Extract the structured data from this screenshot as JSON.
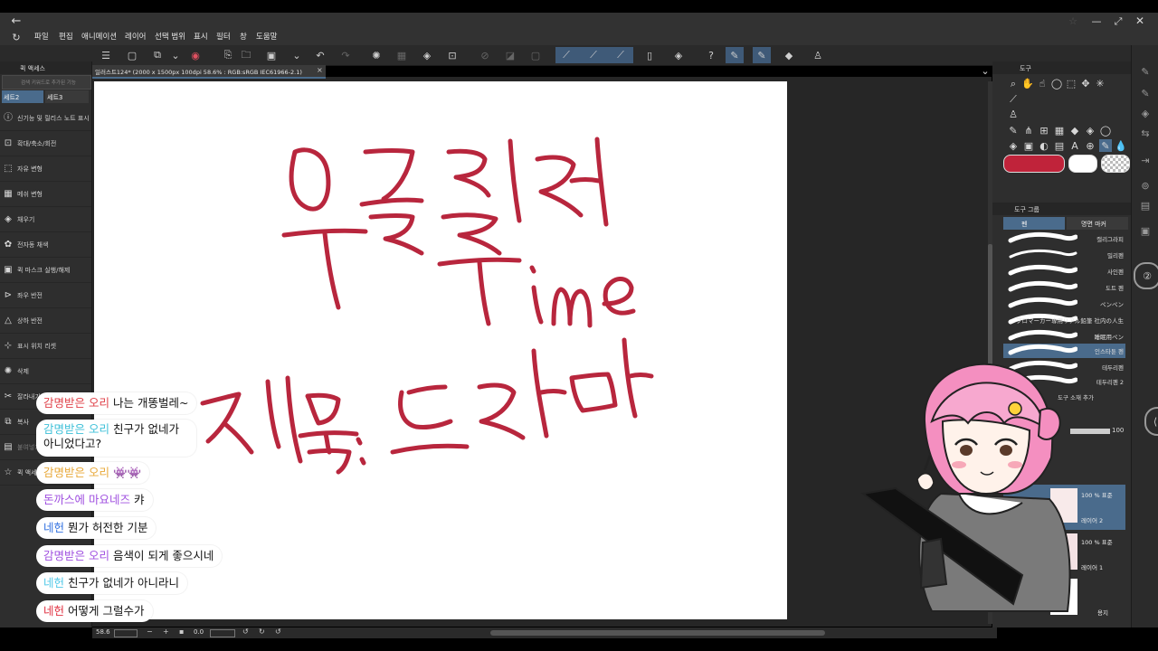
{
  "window": {
    "title": "일러스트124* (2000 x 1500px 100dpi 58.6% : RGB:sRGB IEC61966-2.1)",
    "close_tab": "×"
  },
  "menu": [
    "파일",
    "편집",
    "애니메이션",
    "레이어",
    "선택 범위",
    "표시",
    "필터",
    "창",
    "도움말"
  ],
  "left_panel": {
    "title": "퀵 액세스",
    "search_placeholder": "검색 키워드로 추가된 기능",
    "sets": [
      "세트2",
      "세트3"
    ],
    "items": [
      "신기능 및 릴리스 노트 표시",
      "확대/축소/회전",
      "자유 변형",
      "메쉬 변형",
      "채우기",
      "전자동 채색",
      "퀵 마스크 실행/해제",
      "좌우 반전",
      "상하 반전",
      "표시 위치 리셋",
      "삭제",
      "잘라내기",
      "복사",
      "붙여넣기",
      "퀵 액세스"
    ]
  },
  "canvas": {
    "line1": "우클릴러",
    "line2": "Time",
    "line3": "제목: 드라마",
    "ink_color": "#b8263d"
  },
  "right_panel": {
    "tool_title": "도구",
    "tool_group_title": "도구 그룹",
    "tabs": [
      "펜",
      "명면 마커"
    ],
    "brushes": [
      "캘리그라피",
      "밀리펜",
      "사인펜",
      "도트 펜",
      "ペンペン",
      "プロマーカー専用リアル鉛筆 社内の人生",
      "睡眠用ペン",
      "인스타툰 펜",
      "테두리펜",
      "테두리펜 2"
    ],
    "add_material": "도구 소재 추가",
    "main_color": "#c0233a",
    "sub_color": "#ffffff",
    "layer_blend": "표준",
    "opacity": "100",
    "layers": [
      {
        "mode": "100 % 표준",
        "name": "레이어 2"
      },
      {
        "mode": "100 % 표준",
        "name": "레이어 1"
      },
      {
        "mode": "",
        "name": "용지"
      }
    ]
  },
  "status": {
    "zoom": "58.6",
    "angle": "0.0"
  },
  "chat": [
    {
      "name": "감명받은 오리",
      "name_color": "#e04048",
      "msg": "나는 개똥벌레~"
    },
    {
      "name": "감명받은 오리",
      "name_color": "#3ec0d8",
      "msg": "친구가 없네가 아니었다고?"
    },
    {
      "name": "감명받은 오리",
      "name_color": "#e8a838",
      "msg": "👾👾"
    },
    {
      "name": "돈까스에 마요네즈",
      "name_color": "#a050e0",
      "msg": "캬"
    },
    {
      "name": "네헌",
      "name_color": "#3070e0",
      "msg": "뭔가 허전한 기분"
    },
    {
      "name": "감명받은 오리",
      "name_color": "#a050e0",
      "msg": "음색이 되게 좋으시네"
    },
    {
      "name": "네헌",
      "name_color": "#50c8e8",
      "msg": "친구가 없네가 아니라니"
    },
    {
      "name": "네헌",
      "name_color": "#e03040",
      "msg": "어떻게 그럴수가"
    }
  ]
}
